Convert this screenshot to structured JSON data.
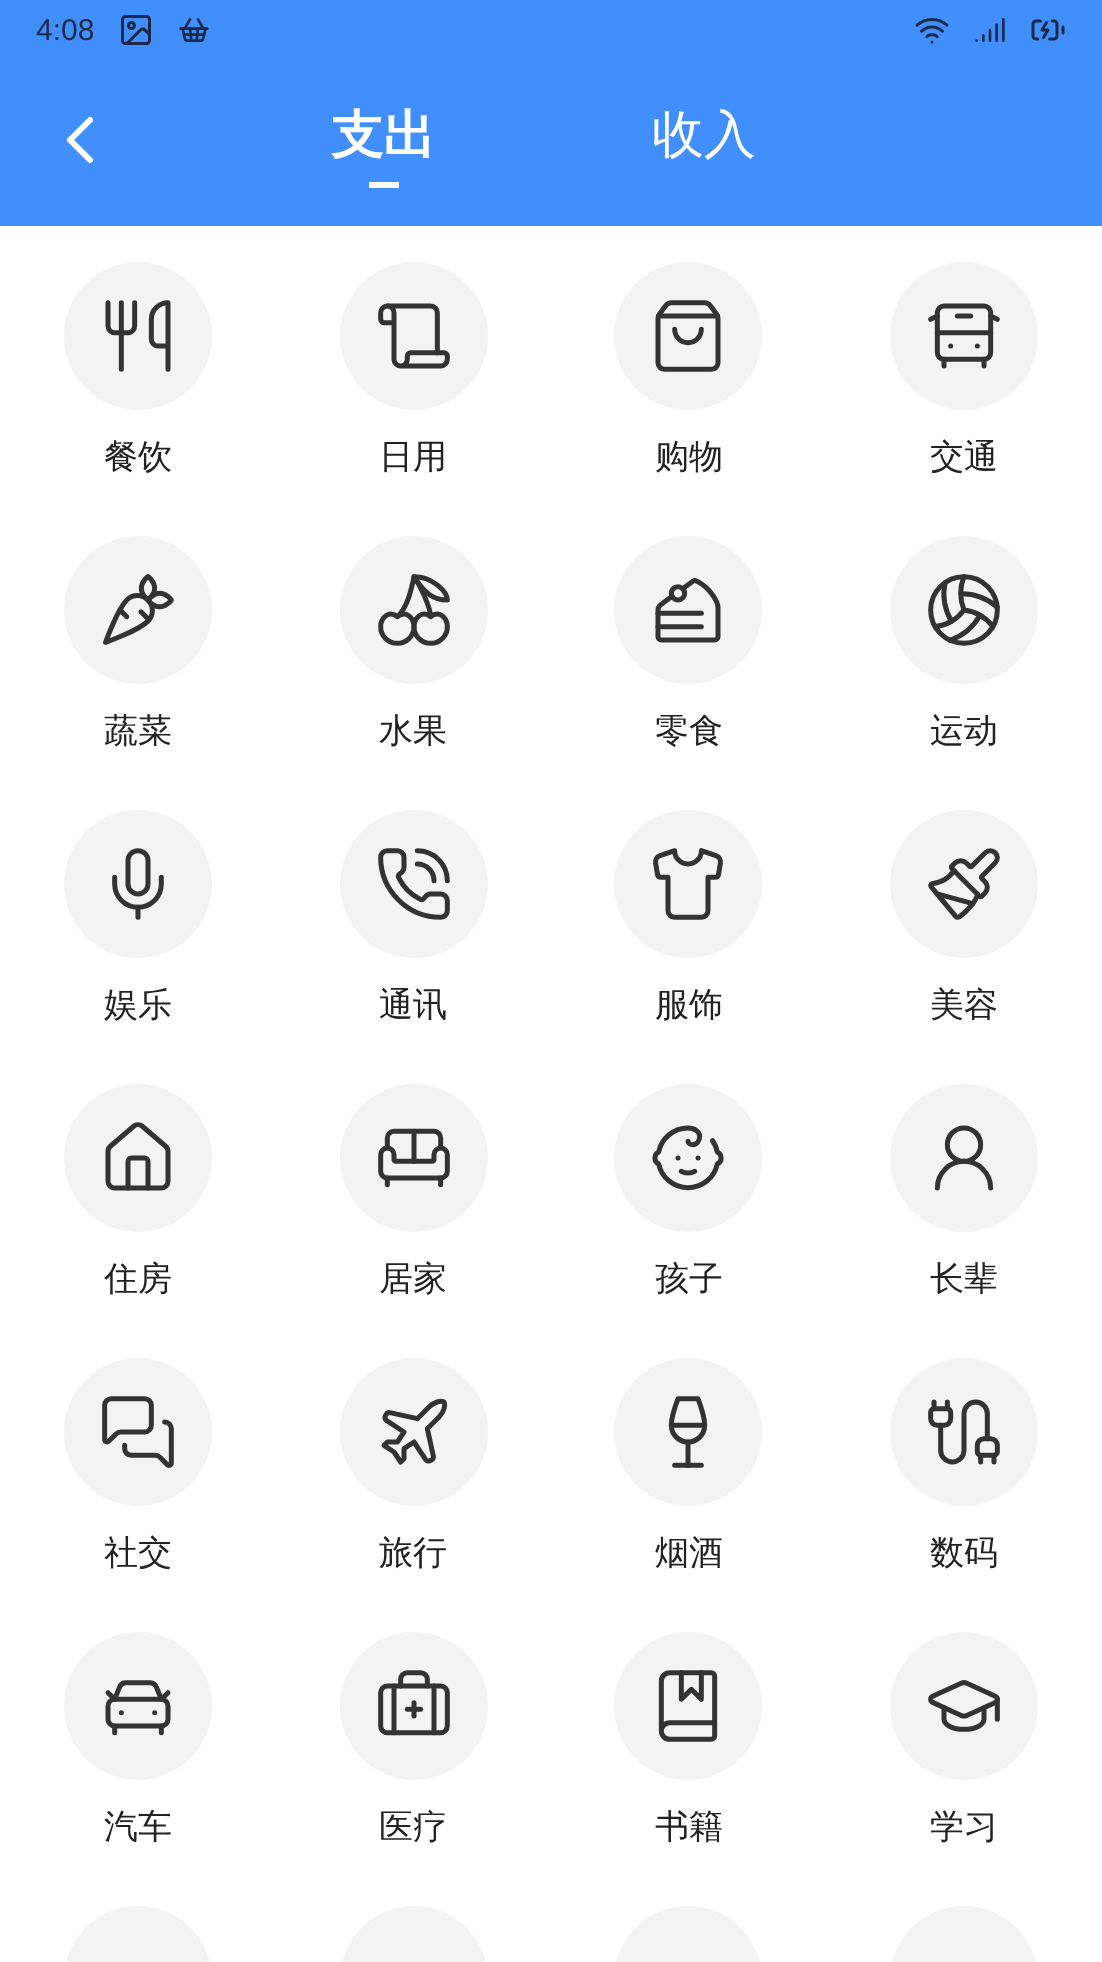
{
  "status_bar": {
    "time": "4:08"
  },
  "tabs": [
    {
      "label": "支出",
      "selected": true
    },
    {
      "label": "收入",
      "selected": false
    }
  ],
  "categories": [
    {
      "label": "餐饮"
    },
    {
      "label": "日用"
    },
    {
      "label": "购物"
    },
    {
      "label": "交通"
    },
    {
      "label": "蔬菜"
    },
    {
      "label": "水果"
    },
    {
      "label": "零食"
    },
    {
      "label": "运动"
    },
    {
      "label": "娱乐"
    },
    {
      "label": "通讯"
    },
    {
      "label": "服饰"
    },
    {
      "label": "美容"
    },
    {
      "label": "住房"
    },
    {
      "label": "居家"
    },
    {
      "label": "孩子"
    },
    {
      "label": "长辈"
    },
    {
      "label": "社交"
    },
    {
      "label": "旅行"
    },
    {
      "label": "烟酒"
    },
    {
      "label": "数码"
    },
    {
      "label": "汽车"
    },
    {
      "label": "医疗"
    },
    {
      "label": "书籍"
    },
    {
      "label": "学习"
    }
  ]
}
